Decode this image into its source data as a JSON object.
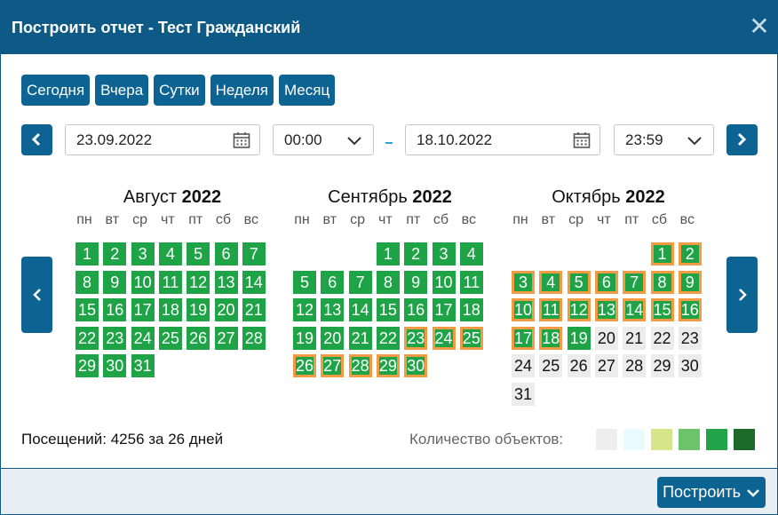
{
  "dialog": {
    "title": "Построить отчет - Тест Гражданский",
    "close_glyph": "✕"
  },
  "presets": [
    "Сегодня",
    "Вчера",
    "Сутки",
    "Неделя",
    "Месяц"
  ],
  "range": {
    "from_date": "23.09.2022",
    "from_time": "00:00",
    "separator": "-",
    "to_date": "18.10.2022",
    "to_time": "23:59"
  },
  "weekdays": [
    "пн",
    "вт",
    "ср",
    "чт",
    "пт",
    "сб",
    "вс"
  ],
  "months": [
    {
      "name": "Август",
      "year": "2022",
      "first_weekday_index": 0,
      "days": 31,
      "visited_to": 31,
      "selected_from": 0,
      "selected_to": 0
    },
    {
      "name": "Сентябрь",
      "year": "2022",
      "first_weekday_index": 3,
      "days": 30,
      "visited_to": 30,
      "selected_from": 23,
      "selected_to": 30
    },
    {
      "name": "Октябрь",
      "year": "2022",
      "first_weekday_index": 5,
      "days": 31,
      "visited_to": 19,
      "selected_from": 1,
      "selected_to": 18
    }
  ],
  "summary": "Посещений: 4256 за 26 дней",
  "legend": {
    "label": "Количество объектов:",
    "colors": [
      "#eeeeee",
      "#e9fbff",
      "#d6e58a",
      "#6cc36a",
      "#21a34a",
      "#1d6a2a"
    ]
  },
  "colors": {
    "header_bg": "#0d5a86",
    "button_bg": "#0d6391",
    "visited_day": "#1ea446",
    "empty_day": "#ececec",
    "selection_border": "#f39a45"
  },
  "footer": {
    "build_label": "Построить"
  },
  "icons": {
    "close": "close-icon",
    "calendar": "calendar-icon",
    "dropdown": "chevron-down-icon",
    "prev": "chevron-left-icon",
    "next": "chevron-right-icon"
  }
}
